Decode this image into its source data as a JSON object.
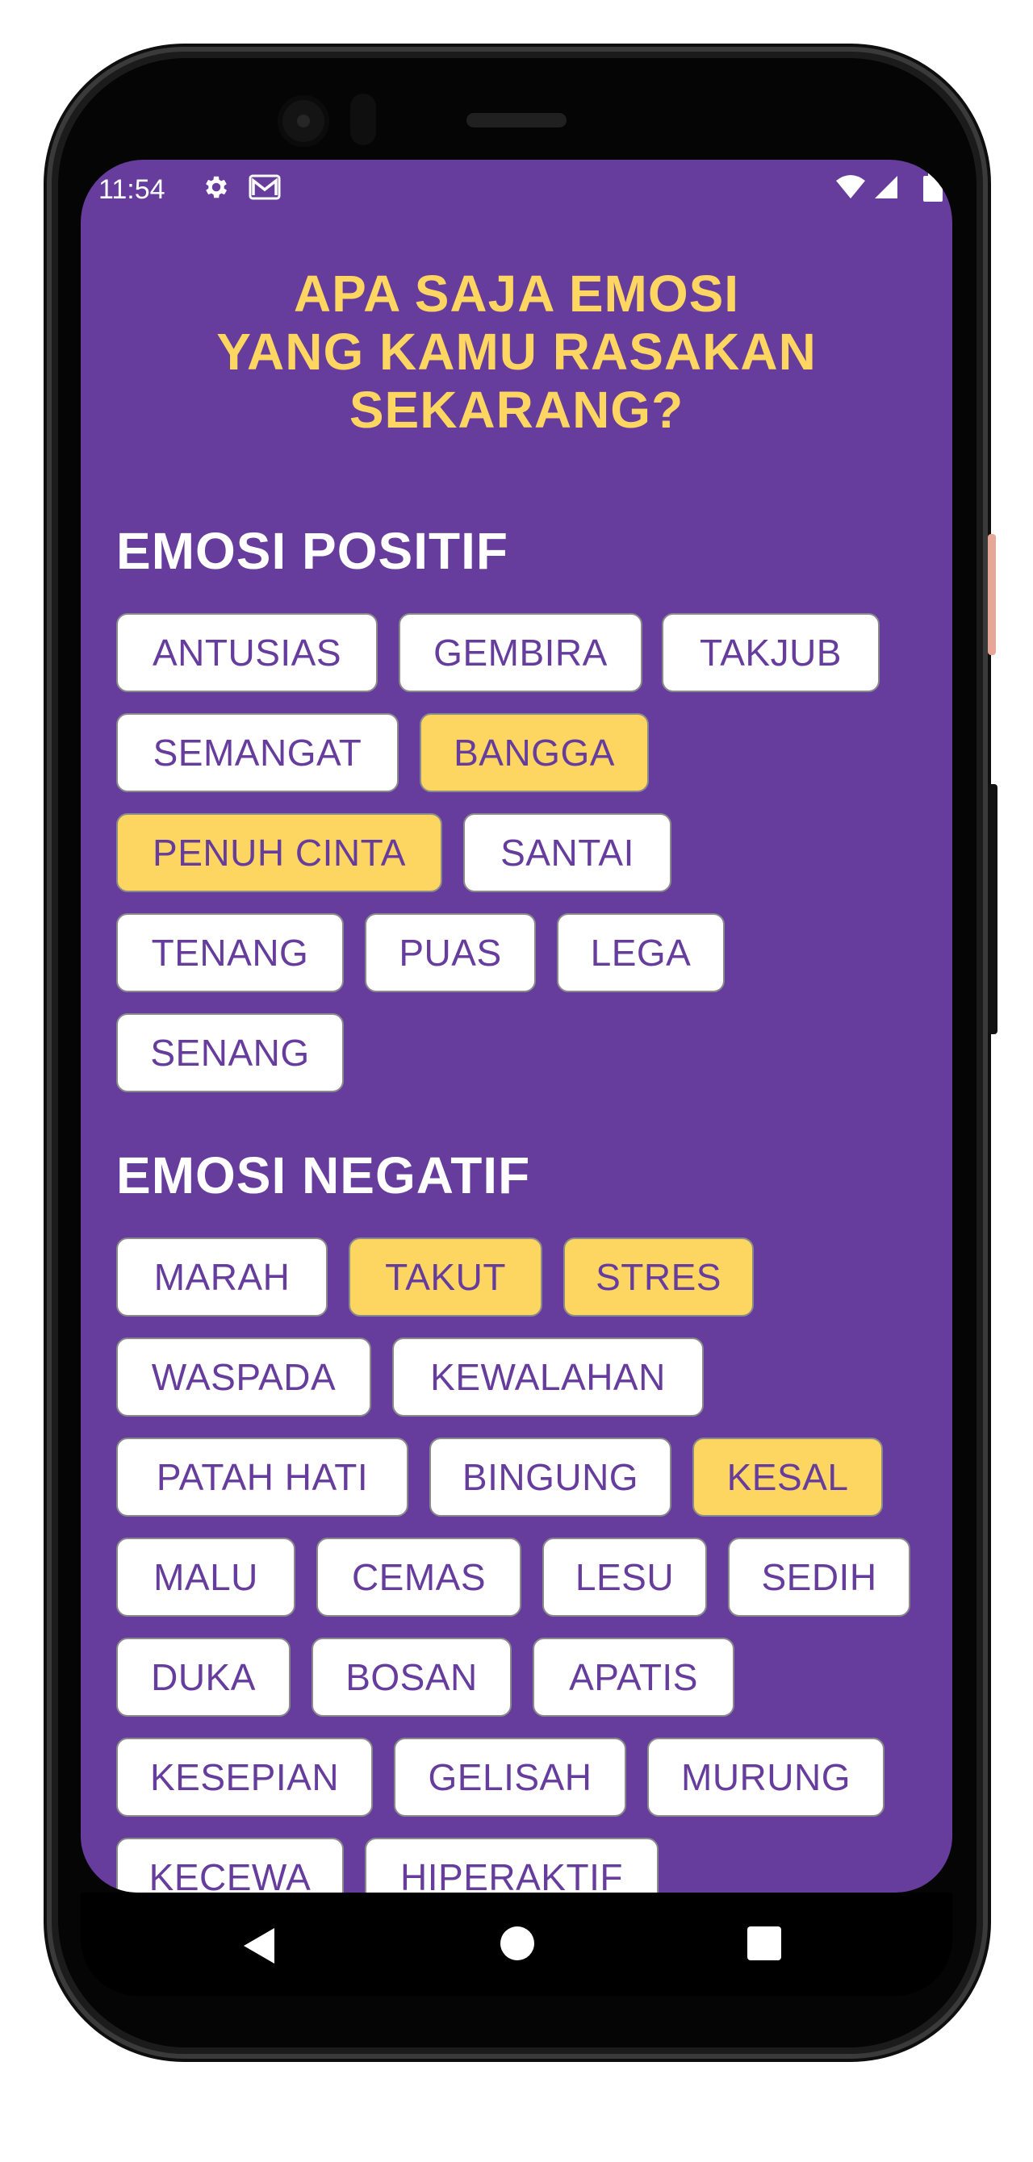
{
  "status_bar": {
    "time": "11:54"
  },
  "question": {
    "line1": "APA SAJA EMOSI",
    "line2": "YANG KAMU RASAKAN",
    "line3": "SEKARANG?"
  },
  "positive": {
    "title": "EMOSI POSITIF",
    "chips": [
      {
        "label": "ANTUSIAS",
        "selected": false
      },
      {
        "label": "GEMBIRA",
        "selected": false
      },
      {
        "label": "TAKJUB",
        "selected": false
      },
      {
        "label": "SEMANGAT",
        "selected": false
      },
      {
        "label": "BANGGA",
        "selected": true
      },
      {
        "label": "PENUH CINTA",
        "selected": true
      },
      {
        "label": "SANTAI",
        "selected": false
      },
      {
        "label": "TENANG",
        "selected": false
      },
      {
        "label": "PUAS",
        "selected": false
      },
      {
        "label": "LEGA",
        "selected": false
      },
      {
        "label": "SENANG",
        "selected": false
      }
    ]
  },
  "negative": {
    "title": "EMOSI NEGATIF",
    "chips": [
      {
        "label": "MARAH",
        "selected": false
      },
      {
        "label": "TAKUT",
        "selected": true
      },
      {
        "label": "STRES",
        "selected": true
      },
      {
        "label": "WASPADA",
        "selected": false
      },
      {
        "label": "KEWALAHAN",
        "selected": false
      },
      {
        "label": "PATAH HATI",
        "selected": false
      },
      {
        "label": "BINGUNG",
        "selected": false
      },
      {
        "label": "KESAL",
        "selected": true
      },
      {
        "label": "MALU",
        "selected": false
      },
      {
        "label": "CEMAS",
        "selected": false
      },
      {
        "label": "LESU",
        "selected": false
      },
      {
        "label": "SEDIH",
        "selected": false
      },
      {
        "label": "DUKA",
        "selected": false
      },
      {
        "label": "BOSAN",
        "selected": false
      },
      {
        "label": "APATIS",
        "selected": false
      },
      {
        "label": "KESEPIAN",
        "selected": false
      },
      {
        "label": "GELISAH",
        "selected": false
      },
      {
        "label": "MURUNG",
        "selected": false
      },
      {
        "label": "KECEWA",
        "selected": false
      },
      {
        "label": "HIPERAKTIF",
        "selected": false
      }
    ]
  },
  "colors": {
    "background": "#663d9d",
    "accent": "#fdd561",
    "chip": "#ffffff",
    "chip_text": "#663d9d"
  },
  "icons": [
    "settings-icon",
    "gmail-icon",
    "wifi-icon",
    "signal-icon",
    "battery-icon",
    "nav-back-icon",
    "nav-home-icon",
    "nav-recents-icon"
  ]
}
